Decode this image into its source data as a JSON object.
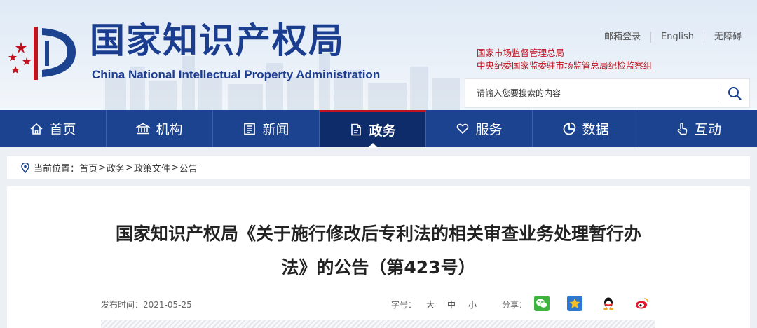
{
  "header": {
    "site_title": "国家知识产权局",
    "site_subtitle": "China National Intellectual Property Administration",
    "top_links": [
      "邮箱登录",
      "English",
      "无障碍"
    ],
    "red_links": [
      "国家市场监督管理总局",
      "中央纪委国家监委驻市场监管总局纪检监察组"
    ],
    "search": {
      "placeholder": "请输入您要搜索的内容",
      "icon": "search-icon"
    },
    "logo_icon": "cnipa-logo-icon"
  },
  "nav": {
    "items": [
      {
        "label": "首页",
        "icon": "home-icon"
      },
      {
        "label": "机构",
        "icon": "building-icon"
      },
      {
        "label": "新闻",
        "icon": "newspaper-icon"
      },
      {
        "label": "政务",
        "icon": "document-icon",
        "active": true
      },
      {
        "label": "服务",
        "icon": "heart-hand-icon"
      },
      {
        "label": "数据",
        "icon": "pie-chart-icon"
      },
      {
        "label": "互动",
        "icon": "touch-icon"
      }
    ]
  },
  "breadcrumb": {
    "prefix": "当前位置：",
    "items": [
      "首页",
      "政务",
      "政策文件",
      "公告"
    ],
    "separator": ">"
  },
  "article": {
    "title_line1": "国家知识产权局《关于施行修改后专利法的相关审查业务处理暂行办",
    "title_line2": "法》的公告（第423号）",
    "date_label": "发布时间：",
    "date": "2021-05-25",
    "font_size_label": "字号：",
    "font_sizes": [
      "大",
      "中",
      "小"
    ],
    "share_label": "分享：",
    "share_targets": [
      "wechat-icon",
      "qzone-icon",
      "qq-icon",
      "weibo-icon"
    ]
  },
  "colors": {
    "brand_blue": "#1b438f",
    "nav_active": "#0e2c6a",
    "accent_red": "#c1121f"
  }
}
